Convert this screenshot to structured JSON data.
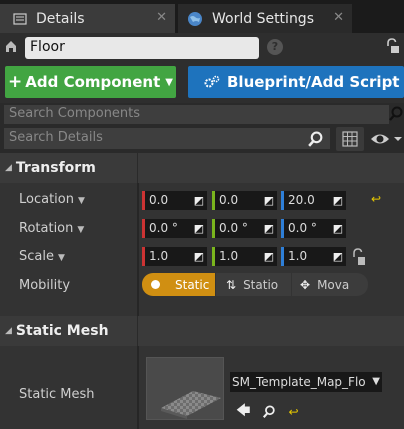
{
  "tabs": [
    {
      "label": "Details",
      "icon": "details-icon"
    },
    {
      "label": "World Settings",
      "icon": "globe-icon"
    }
  ],
  "actor": {
    "name": "Floor",
    "icon": "actor-icon"
  },
  "toolbar": {
    "add_component_label": "Add Component",
    "blueprint_label": "Blueprint/Add Script",
    "add_color": "#42a542",
    "blueprint_color": "#1e73bd"
  },
  "search": {
    "components_placeholder": "Search Components",
    "details_placeholder": "Search Details"
  },
  "transform": {
    "header": "Transform",
    "location": {
      "label": "Location",
      "x": "0.0",
      "y": "0.0",
      "z": "20.0"
    },
    "rotation": {
      "label": "Rotation",
      "x": "0.0 °",
      "y": "0.0 °",
      "z": "0.0 °"
    },
    "scale": {
      "label": "Scale",
      "x": "1.0",
      "y": "1.0",
      "z": "1.0"
    },
    "mobility": {
      "label": "Mobility",
      "options": [
        "Static",
        "Statio",
        "Mova"
      ],
      "selected": "Static"
    }
  },
  "static_mesh": {
    "header": "Static Mesh",
    "label": "Static Mesh",
    "value": "SM_Template_Map_Flo"
  },
  "colors": {
    "x_axis": "#cc3333",
    "y_axis": "#7ab51d",
    "z_axis": "#2e7fd8",
    "selected": "#d08f12"
  }
}
